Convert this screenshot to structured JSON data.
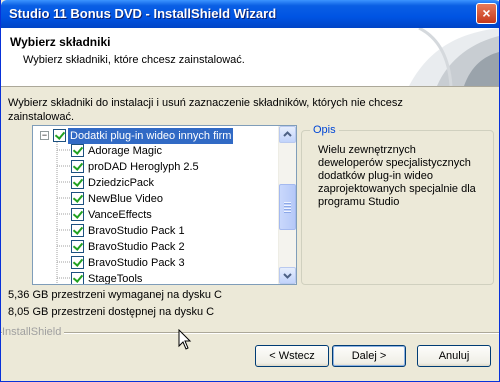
{
  "window": {
    "title": "Studio 11 Bonus DVD - InstallShield Wizard",
    "close_glyph": "×"
  },
  "header": {
    "title": "Wybierz składniki",
    "subtitle": "Wybierz składniki, które chcesz zainstalować."
  },
  "instructions": "Wybierz składniki do instalacji i usuń zaznaczenie składników, których nie chcesz zainstalować.",
  "tree": {
    "items": [
      {
        "label": "Dodatki plug-in wideo innych firm",
        "checked": true,
        "expanded": true,
        "selected": true,
        "level": 0
      },
      {
        "label": "Adorage Magic",
        "checked": true,
        "level": 1
      },
      {
        "label": "proDAD Heroglyph 2.5",
        "checked": true,
        "level": 1
      },
      {
        "label": "DziedzicPack",
        "checked": true,
        "level": 1
      },
      {
        "label": "NewBlue Video",
        "checked": true,
        "level": 1
      },
      {
        "label": "VanceEffects",
        "checked": true,
        "level": 1
      },
      {
        "label": "BravoStudio Pack 1",
        "checked": true,
        "level": 1
      },
      {
        "label": "BravoStudio Pack 2",
        "checked": true,
        "level": 1
      },
      {
        "label": "BravoStudio Pack 3",
        "checked": true,
        "level": 1
      },
      {
        "label": "StageTools",
        "checked": true,
        "level": 1
      }
    ]
  },
  "description": {
    "legend": "Opis",
    "text": "Wielu zewnętrznych deweloperów specjalistycznych dodatków plug-in wideo zaprojektowanych specjalnie dla programu Studio"
  },
  "space": {
    "required": "5,36 GB przestrzeni wymaganej na dysku C",
    "available": "8,05 GB przestrzeni dostępnej na dysku C"
  },
  "brand": "InstallShield",
  "buttons": {
    "back": "< Wstecz",
    "next": "Dalej >",
    "cancel": "Anuluj"
  },
  "colors": {
    "title_bar": "#0054e3",
    "selection": "#316ac5",
    "check": "#21a121",
    "legend": "#0046d5"
  }
}
